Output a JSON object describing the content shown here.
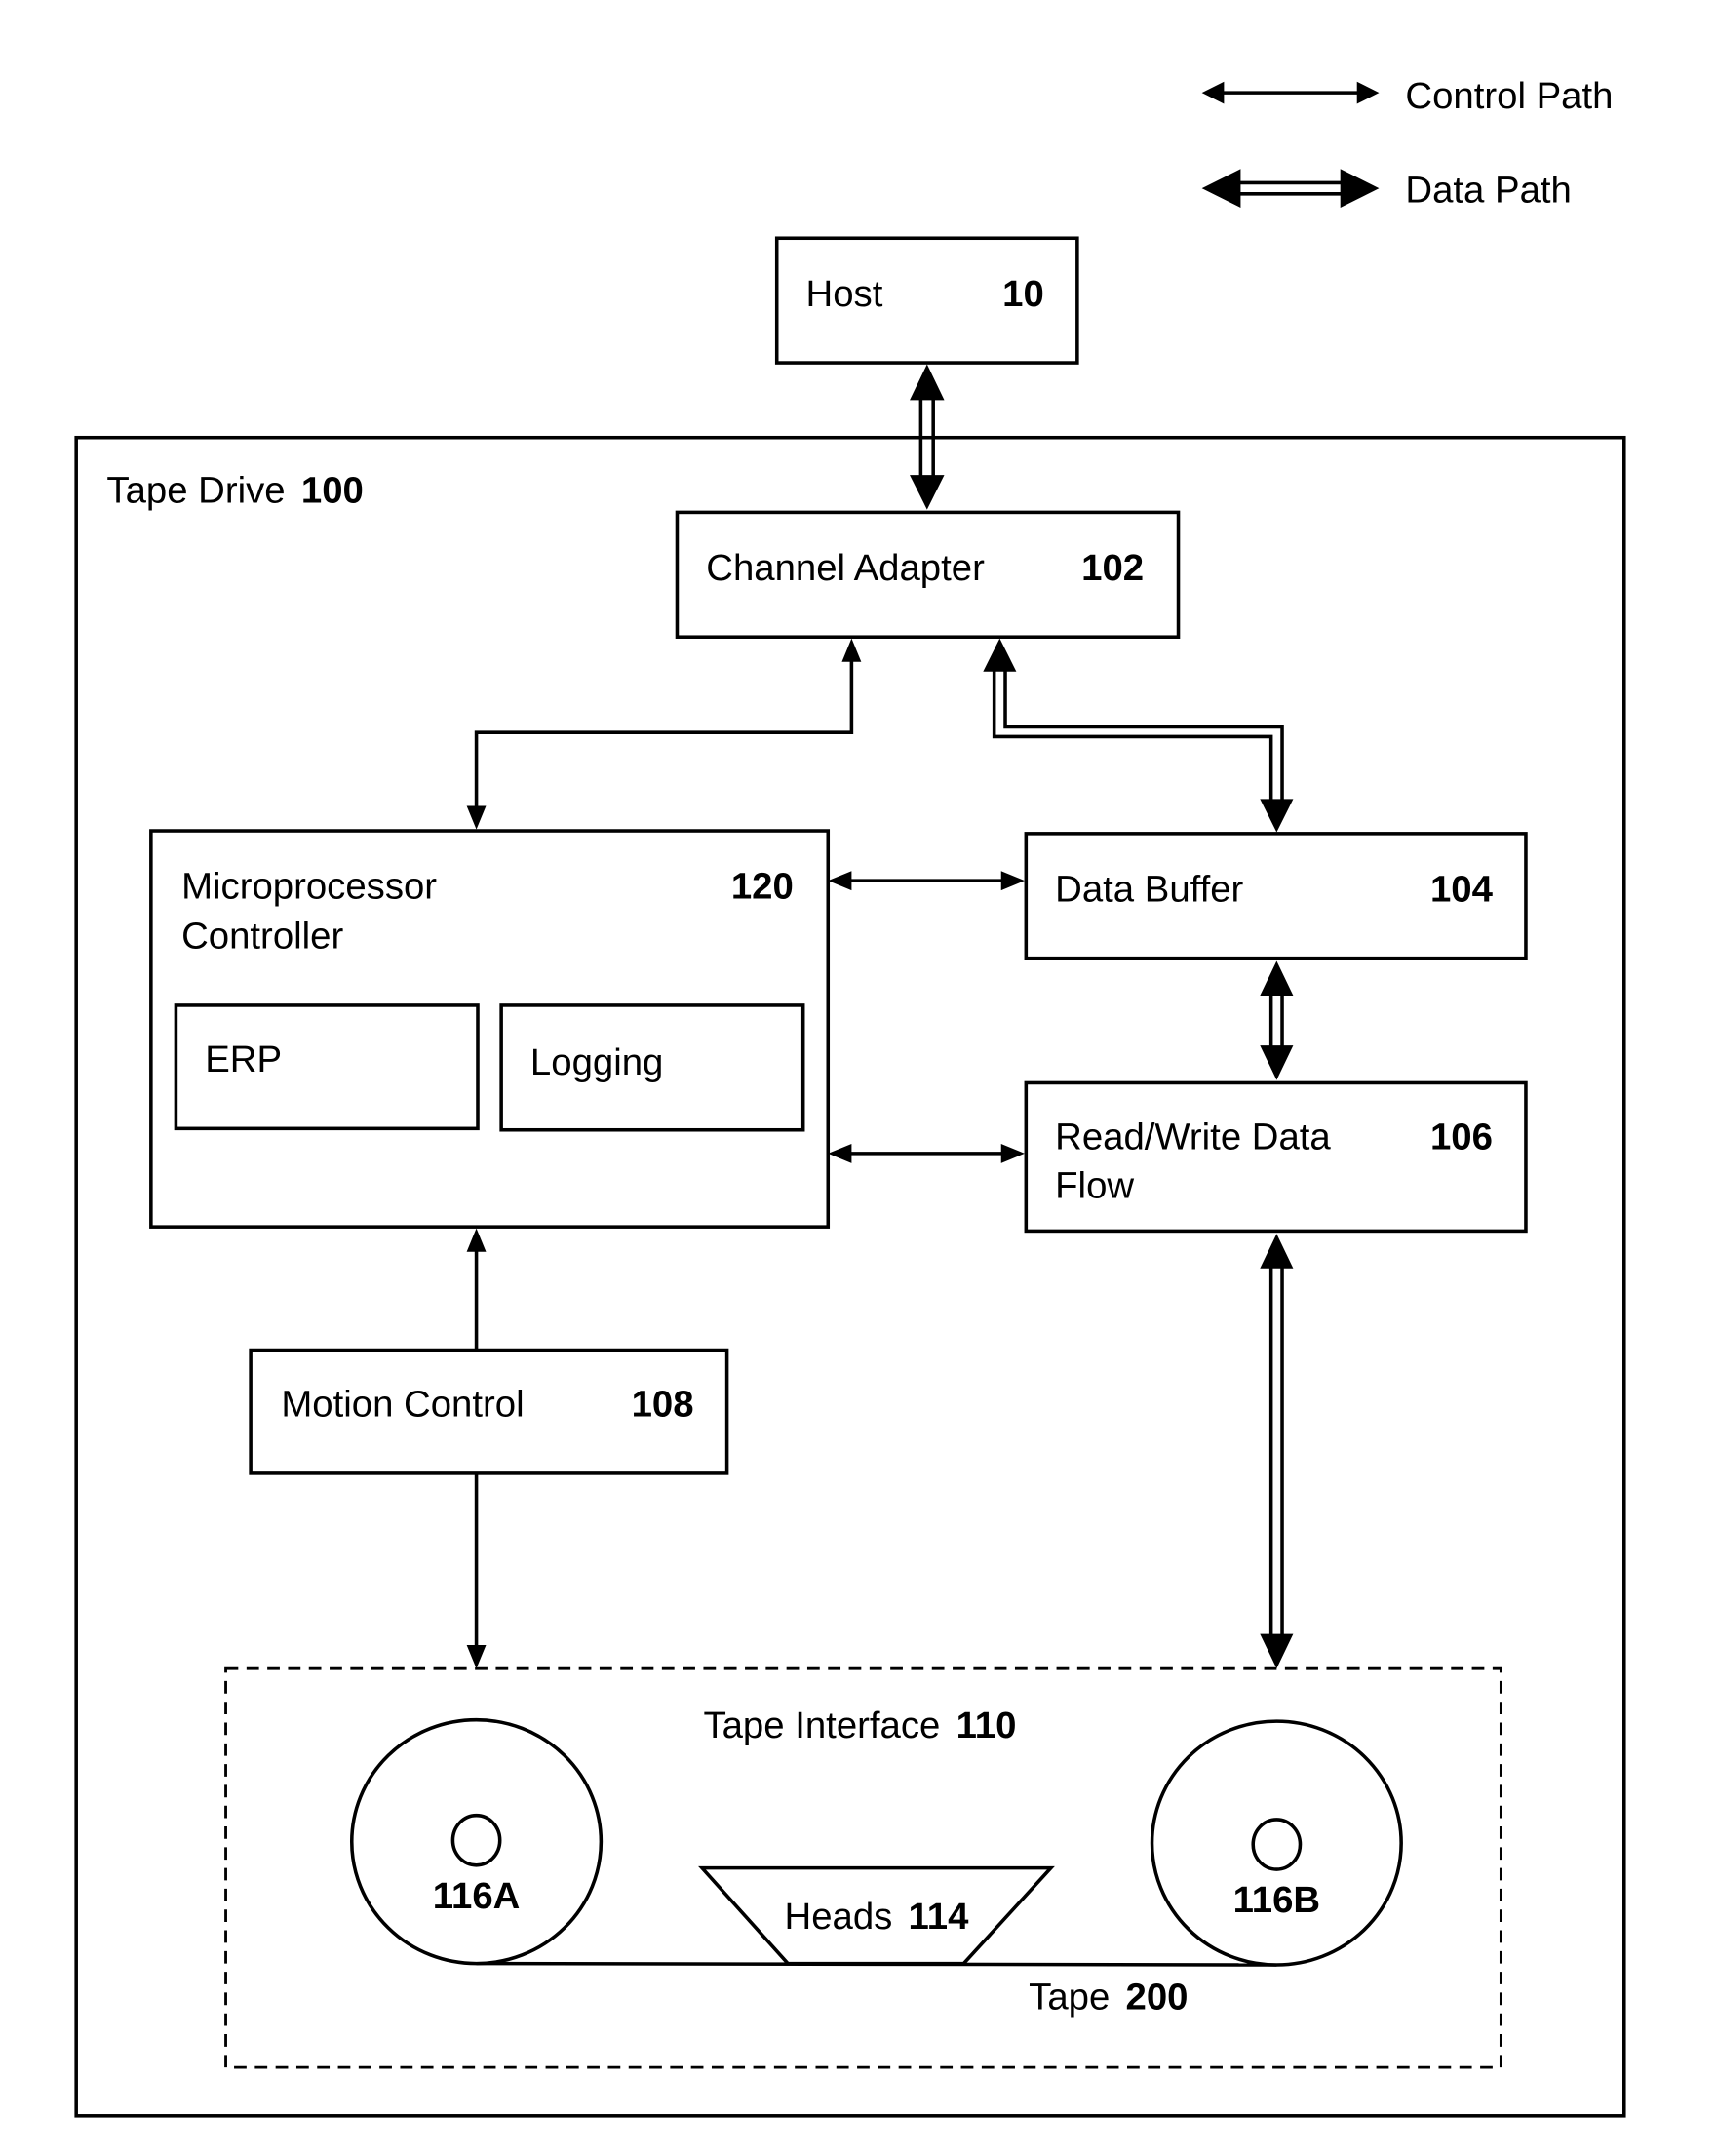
{
  "legend": {
    "control_path": "Control Path",
    "data_path": "Data Path"
  },
  "nodes": {
    "host": {
      "label": "Host",
      "number": "10"
    },
    "tape_drive": {
      "label": "Tape Drive",
      "number": "100"
    },
    "channel_adapter": {
      "label": "Channel Adapter",
      "number": "102"
    },
    "microprocessor": {
      "label_line1": "Microprocessor",
      "label_line2": "Controller",
      "number": "120"
    },
    "erp": {
      "label": "ERP"
    },
    "logging": {
      "label": "Logging"
    },
    "data_buffer": {
      "label": "Data Buffer",
      "number": "104"
    },
    "rw_data_flow": {
      "label_line1": "Read/Write Data",
      "label_line2": "Flow",
      "number": "106"
    },
    "motion_control": {
      "label": "Motion Control",
      "number": "108"
    },
    "tape_interface": {
      "label": "Tape Interface",
      "number": "110"
    },
    "reel_a": {
      "label": "116A"
    },
    "reel_b": {
      "label": "116B"
    },
    "heads": {
      "label": "Heads",
      "number": "114"
    },
    "tape": {
      "label": "Tape",
      "number": "200"
    }
  },
  "edges": [
    {
      "from": "host",
      "to": "channel_adapter",
      "type": "data"
    },
    {
      "from": "channel_adapter",
      "to": "microprocessor",
      "type": "control"
    },
    {
      "from": "channel_adapter",
      "to": "data_buffer",
      "type": "data"
    },
    {
      "from": "microprocessor",
      "to": "data_buffer",
      "type": "control"
    },
    {
      "from": "microprocessor",
      "to": "rw_data_flow",
      "type": "control"
    },
    {
      "from": "data_buffer",
      "to": "rw_data_flow",
      "type": "data"
    },
    {
      "from": "motion_control",
      "to": "microprocessor",
      "type": "control"
    },
    {
      "from": "motion_control",
      "to": "tape_interface",
      "type": "control"
    },
    {
      "from": "rw_data_flow",
      "to": "tape_interface",
      "type": "data"
    }
  ]
}
